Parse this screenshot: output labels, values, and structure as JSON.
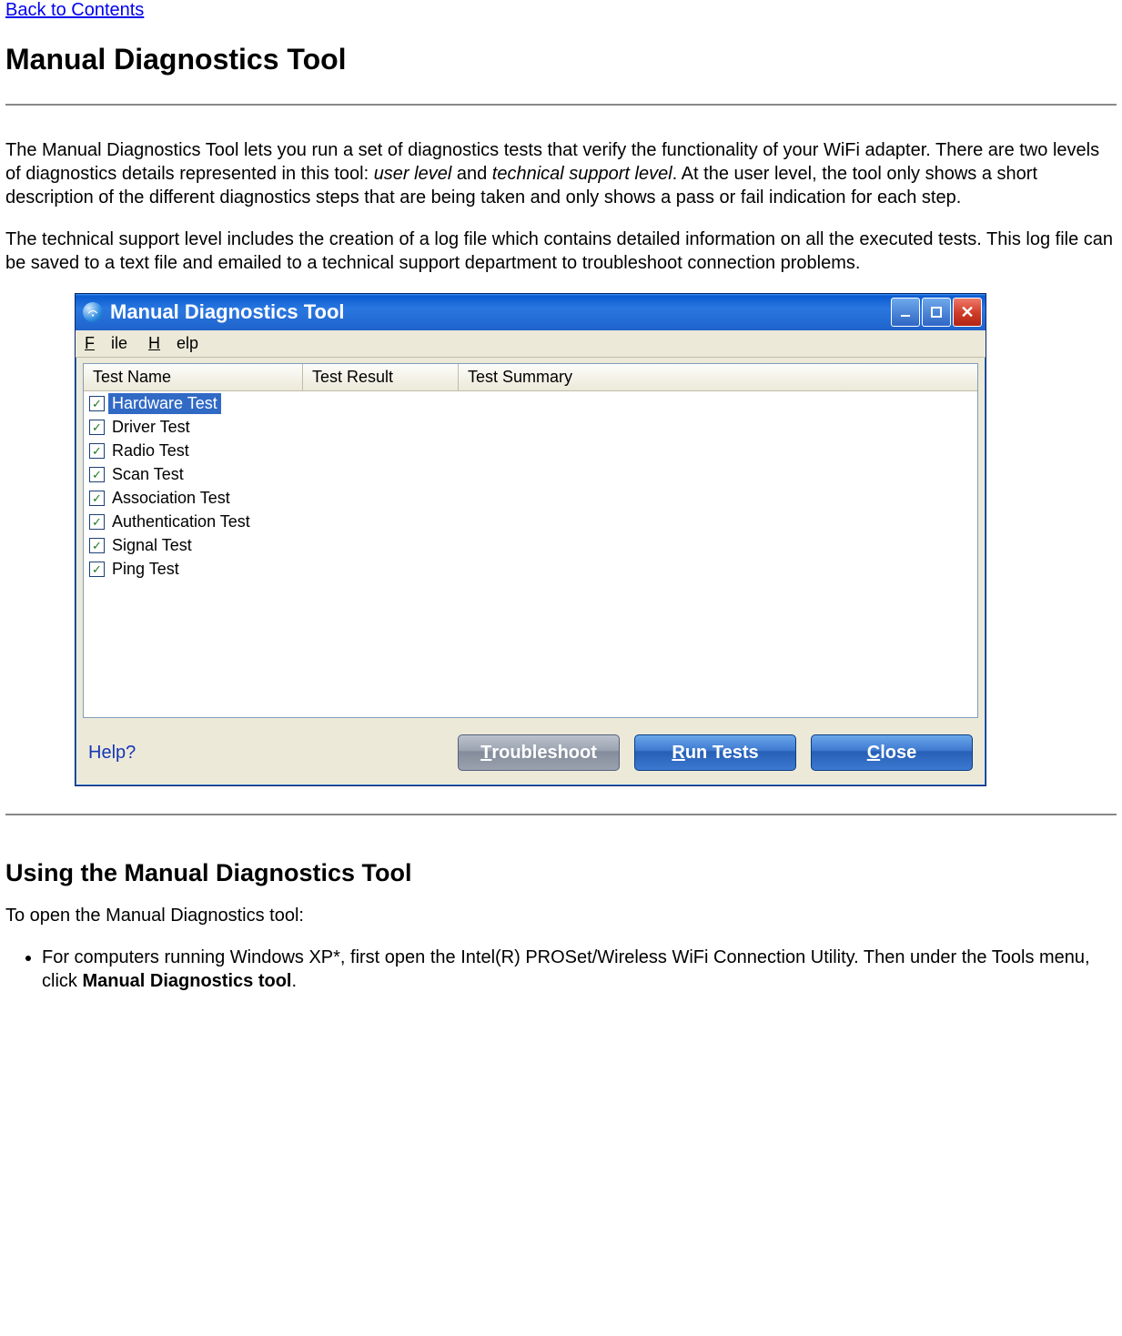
{
  "nav": {
    "back_link": "Back to Contents"
  },
  "headings": {
    "h1": "Manual Diagnostics Tool",
    "h2": "Using the Manual Diagnostics Tool"
  },
  "paragraphs": {
    "p1_a": "The Manual Diagnostics Tool lets you run a set of diagnostics tests that verify the functionality of your WiFi adapter. There are two levels of diagnostics details represented in this tool: ",
    "p1_i1": "user level",
    "p1_b": " and ",
    "p1_i2": "technical support level",
    "p1_c": ". At the user level, the tool only shows a short description of the different diagnostics steps that are being taken and only shows a pass or fail indication for each step.",
    "p2": "The technical support level includes the creation of a log file which contains detailed information on all the executed tests. This log file can be saved to a text file and emailed to a technical support department to troubleshoot connection problems.",
    "p3": "To open the Manual Diagnostics tool:"
  },
  "list": {
    "item1_a": "For computers running Windows XP*, first open the Intel(R) PROSet/Wireless WiFi Connection Utility. Then under the Tools menu, click ",
    "item1_bold": "Manual Diagnostics tool",
    "item1_b": "."
  },
  "dialog": {
    "title": "Manual Diagnostics Tool",
    "menu": {
      "file": "File",
      "help": "Help"
    },
    "columns": {
      "name": "Test Name",
      "result": "Test Result",
      "summary": "Test Summary"
    },
    "tests": [
      {
        "label": "Hardware Test",
        "checked": true,
        "selected": true
      },
      {
        "label": "Driver Test",
        "checked": true,
        "selected": false
      },
      {
        "label": "Radio Test",
        "checked": true,
        "selected": false
      },
      {
        "label": "Scan Test",
        "checked": true,
        "selected": false
      },
      {
        "label": "Association Test",
        "checked": true,
        "selected": false
      },
      {
        "label": "Authentication Test",
        "checked": true,
        "selected": false
      },
      {
        "label": "Signal Test",
        "checked": true,
        "selected": false
      },
      {
        "label": "Ping Test",
        "checked": true,
        "selected": false
      }
    ],
    "help_link": "Help?",
    "buttons": {
      "troubleshoot": "Troubleshoot",
      "run": "Run Tests",
      "close": "Close"
    }
  }
}
